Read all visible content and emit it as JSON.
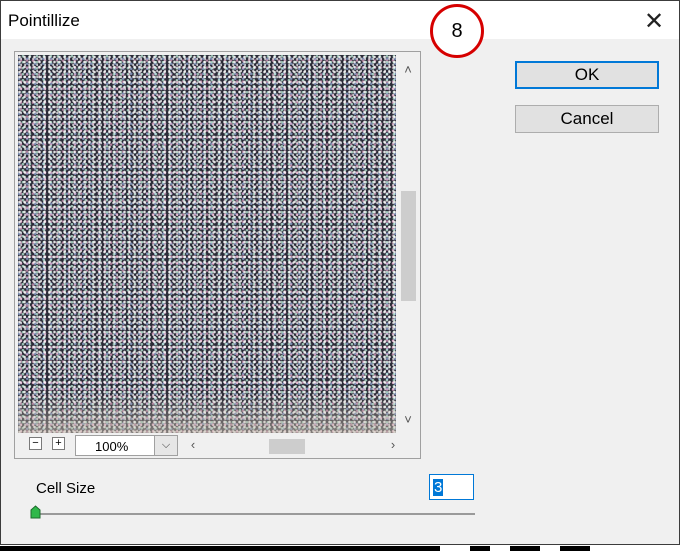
{
  "window": {
    "title": "Pointillize",
    "close_glyph": "✕"
  },
  "annotation": {
    "number": "8",
    "color": "#d60000"
  },
  "preview": {
    "zoom_out_glyph": "−",
    "zoom_in_glyph": "+",
    "zoom_value": "100%",
    "zoom_dropdown_glyph": "⌵",
    "scroll_up_glyph": "˄",
    "scroll_down_glyph": "˅",
    "scroll_left_glyph": "‹",
    "scroll_right_glyph": "›"
  },
  "buttons": {
    "ok_label": "OK",
    "cancel_label": "Cancel"
  },
  "cell_size": {
    "label": "Cell Size",
    "value": "3"
  },
  "colors": {
    "dialog_bg": "#f0f0f0",
    "accent": "#0078d7",
    "button_bg": "#e1e1e1"
  }
}
